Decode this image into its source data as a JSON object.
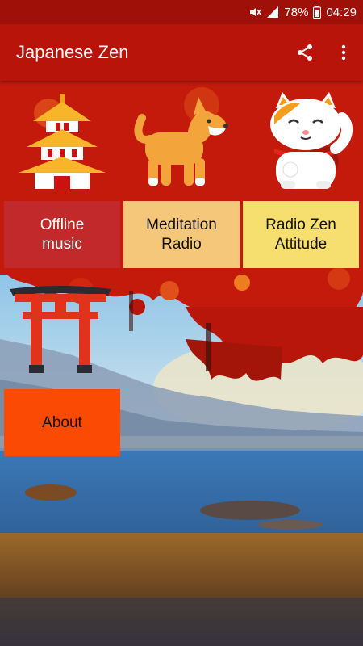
{
  "status_bar": {
    "battery": "78%",
    "time": "04:29",
    "icons": [
      "mute-icon",
      "signal-icon",
      "battery-icon"
    ]
  },
  "app_bar": {
    "title": "Japanese Zen",
    "actions": [
      "share-icon",
      "more-vert-icon"
    ]
  },
  "illustrations": [
    "pagoda-icon",
    "shiba-dog-icon",
    "lucky-cat-icon",
    "torii-gate-icon"
  ],
  "tiles": {
    "offline_music": "Offline\nmusic",
    "meditation_radio": "Meditation\nRadio",
    "radio_zen_attitude": "Radio Zen\nAttitude",
    "about": "About"
  },
  "colors": {
    "status_bar": "#9e1008",
    "app_bar": "#b91409",
    "offline_tile": "#c1292b",
    "meditation_tile": "#f5c77a",
    "radio_zen_tile": "#f6df6e",
    "about_tile": "#fb4a04"
  }
}
